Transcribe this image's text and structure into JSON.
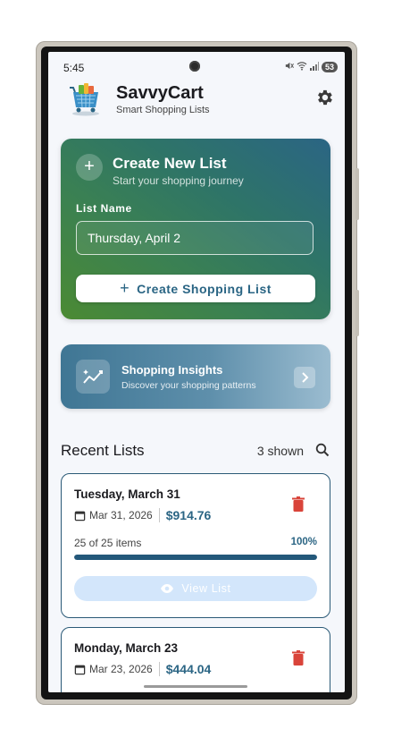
{
  "status_bar": {
    "time": "5:45",
    "battery": "53"
  },
  "app": {
    "name": "SavvyCart",
    "tagline": "Smart Shopping Lists"
  },
  "create_card": {
    "title": "Create New List",
    "subtitle": "Start your shopping journey",
    "field_label": "List Name",
    "field_value": "Thursday, April 2",
    "button_label": "Create Shopping List"
  },
  "insights": {
    "title": "Shopping Insights",
    "subtitle": "Discover your shopping patterns"
  },
  "recent": {
    "title": "Recent Lists",
    "count_label": "3 shown",
    "lists": [
      {
        "title": "Tuesday, March 31",
        "date": "Mar 31, 2026",
        "total": "$914.76",
        "items_label": "25 of 25 items",
        "percent_label": "100%",
        "progress": 1.0,
        "view_label": "View List"
      },
      {
        "title": "Monday, March 23",
        "date": "Mar 23, 2026",
        "total": "$444.04"
      }
    ]
  },
  "colors": {
    "accent": "#2b6584",
    "delete": "#d9443a",
    "gradient_green": "#4b8a33",
    "gradient_blue": "#2b6584"
  },
  "icons": {
    "settings": "gear-icon",
    "search": "search-icon",
    "delete": "trash-icon",
    "calendar": "calendar-icon",
    "view": "eye-icon",
    "insights": "trend-icon",
    "arrow": "chevron-right-icon"
  }
}
